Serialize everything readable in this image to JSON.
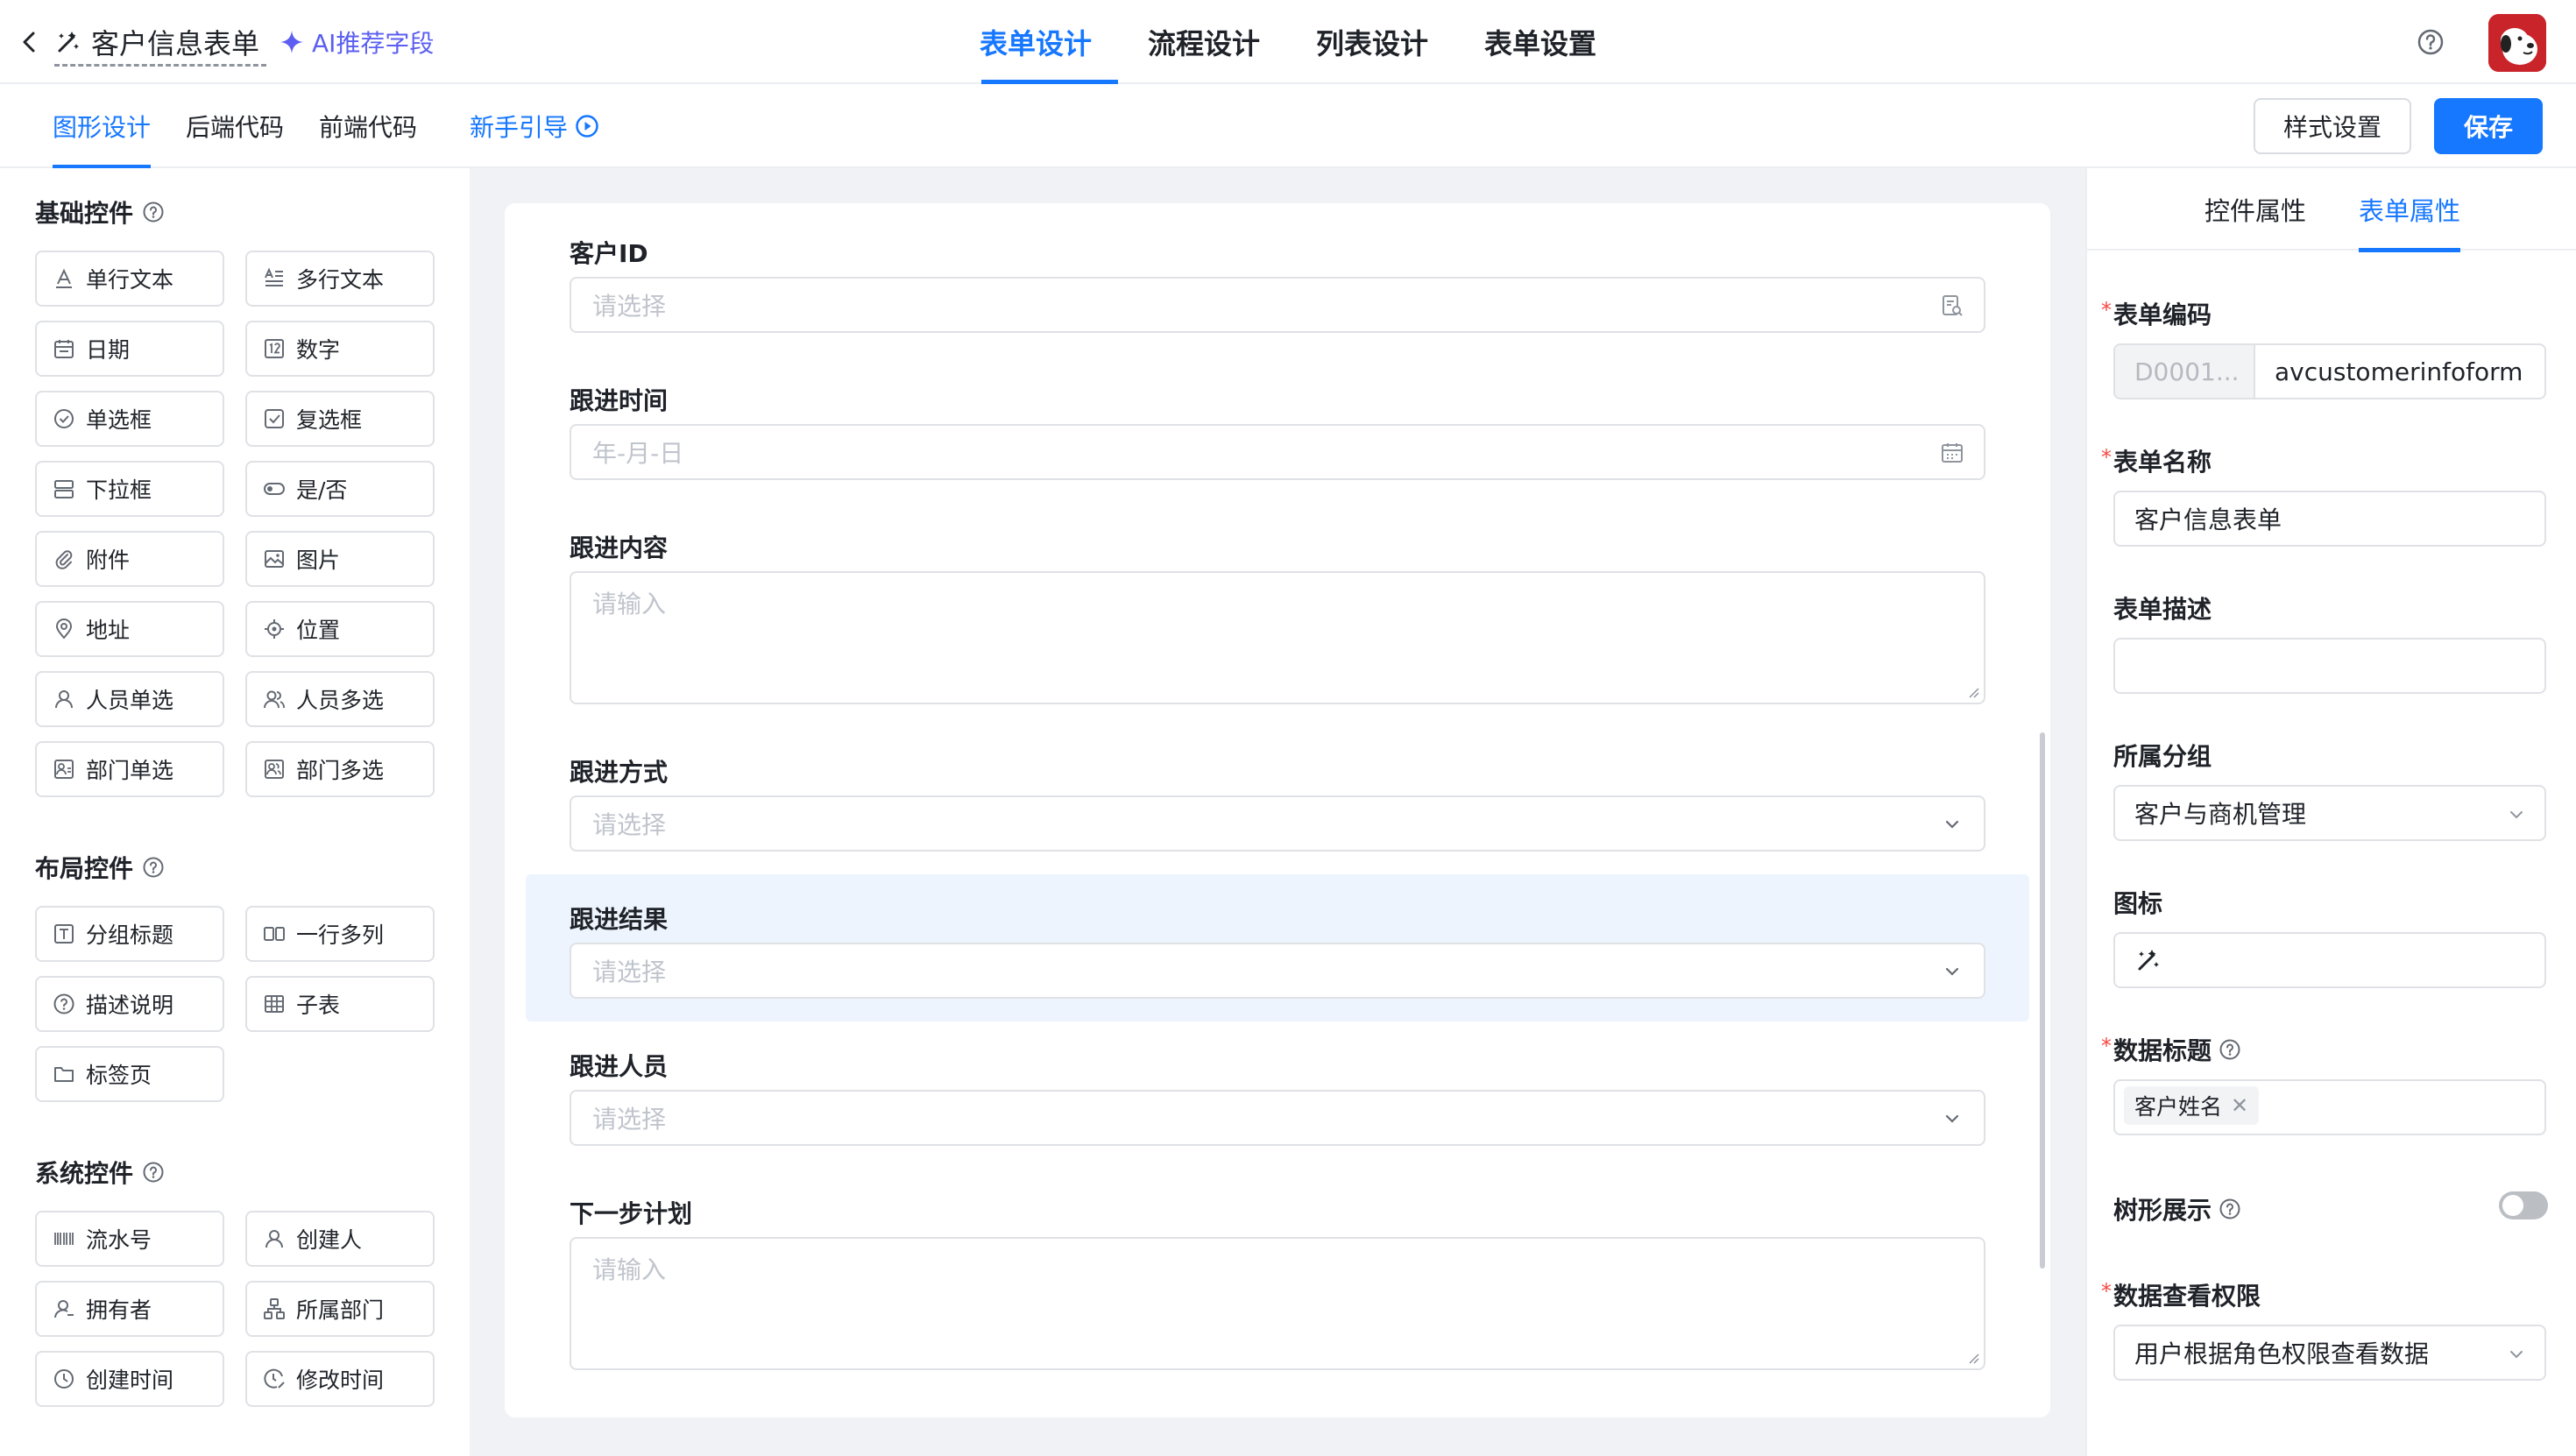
{
  "header": {
    "title": "客户信息表单",
    "main_tabs": [
      "表单设计",
      "流程设计",
      "列表设计",
      "表单设置"
    ],
    "active_tab": "表单设计"
  },
  "subheader": {
    "tabs": [
      "图形设计",
      "后端代码",
      "前端代码"
    ],
    "active_tab": "图形设计",
    "guide_label": "新手引导",
    "style_button": "样式设置",
    "save_button": "保存"
  },
  "palette": {
    "basic_title": "基础控件",
    "ai_link": "AI推荐字段",
    "basic_items": [
      "单行文本",
      "多行文本",
      "日期",
      "数字",
      "单选框",
      "复选框",
      "下拉框",
      "是/否",
      "附件",
      "图片",
      "地址",
      "位置",
      "人员单选",
      "人员多选",
      "部门单选",
      "部门多选"
    ],
    "layout_title": "布局控件",
    "layout_items": [
      "分组标题",
      "一行多列",
      "描述说明",
      "子表",
      "标签页"
    ],
    "system_title": "系统控件",
    "system_items": [
      "流水号",
      "创建人",
      "拥有者",
      "所属部门",
      "创建时间",
      "修改时间"
    ]
  },
  "form": {
    "fields": [
      {
        "label": "客户ID",
        "placeholder": "请选择",
        "type": "lookup"
      },
      {
        "label": "跟进时间",
        "placeholder": "年-月-日",
        "type": "date"
      },
      {
        "label": "跟进内容",
        "placeholder": "请输入",
        "type": "textarea"
      },
      {
        "label": "跟进方式",
        "placeholder": "请选择",
        "type": "select"
      },
      {
        "label": "跟进结果",
        "placeholder": "请选择",
        "type": "select",
        "selected": true
      },
      {
        "label": "跟进人员",
        "placeholder": "请选择",
        "type": "select"
      },
      {
        "label": "下一步计划",
        "placeholder": "请输入",
        "type": "textarea"
      }
    ]
  },
  "properties": {
    "tabs": [
      "控件属性",
      "表单属性"
    ],
    "active_tab": "表单属性",
    "form_code_label": "表单编码",
    "form_code_prefix": "D0001...",
    "form_code_value": "avcustomerinfoform",
    "form_name_label": "表单名称",
    "form_name_value": "客户信息表单",
    "form_desc_label": "表单描述",
    "form_desc_value": "",
    "group_label": "所属分组",
    "group_value": "客户与商机管理",
    "icon_label": "图标",
    "icon_name": "magic-wand-icon",
    "data_title_label": "数据标题",
    "data_title_tag": "客户姓名",
    "tree_label": "树形展示",
    "tree_enabled": false,
    "permission_label": "数据查看权限",
    "permission_value": "用户根据角色权限查看数据"
  },
  "colors": {
    "accent": "#1677ff",
    "required": "#f54a45",
    "ai": "#5b5ef0",
    "canvas_bg": "#f1f2f5",
    "selected_bg": "#eef4fd"
  }
}
